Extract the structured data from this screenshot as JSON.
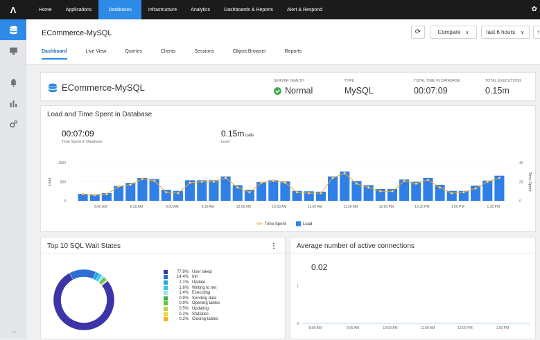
{
  "topnav": {
    "logo": "Λ",
    "items": [
      "Home",
      "Applications",
      "Databases",
      "Infrastructure",
      "Analytics",
      "Dashboards & Reports",
      "Alert & Respond"
    ],
    "active_index": 2
  },
  "header": {
    "db_name": "ECommerce-MySQL",
    "compare_label": "Compare",
    "time_range": "last 6 hours",
    "tabs": [
      "Dashboard",
      "Live View",
      "Queries",
      "Clients",
      "Sessions",
      "Object Browser",
      "Reports"
    ],
    "active_tab_index": 0
  },
  "kpis": {
    "title": "ECommerce-MySQL",
    "server_health_label": "SERVER HEALTH",
    "server_health_value": "Normal",
    "type_label": "TYPE",
    "type_value": "MySQL",
    "time_label": "TOTAL TIME IN DATABASE",
    "time_value": "00:07:09",
    "exec_label": "TOTAL EXECUTIONS",
    "exec_value": "0.15m"
  },
  "load_panel": {
    "title": "Load and Time Spent in Database",
    "time_value": "00:07:09",
    "time_caption": "Time Spent in Database",
    "calls_value": "0.15m",
    "calls_unit": "calls",
    "calls_caption": "Load"
  },
  "wait_panel": {
    "title": "Top 10 SQL Wait States",
    "menu_icon": "⋮"
  },
  "conn_panel": {
    "title": "Average number of active connections",
    "value": "0.02"
  },
  "chart_data": [
    {
      "type": "bar",
      "ylabel": "Load",
      "y2label": "Time Spent",
      "ylim": [
        0,
        1000
      ],
      "y2lim": [
        0,
        40
      ],
      "yticks": [
        "1000",
        "500",
        "0"
      ],
      "y2ticks": [
        "40",
        "20",
        "0"
      ],
      "xticks": [
        "8:00 AM",
        "8:30 AM",
        "9:00 AM",
        "9:30 AM",
        "10:00 AM",
        "10:30 AM",
        "11:00 AM",
        "11:30 AM",
        "12:00 PM",
        "12:30 PM",
        "1:00 PM",
        "1:30 PM"
      ],
      "series": [
        {
          "name": "Load",
          "type": "bar",
          "values": [
            180,
            170,
            200,
            390,
            470,
            600,
            570,
            290,
            260,
            540,
            540,
            540,
            640,
            410,
            290,
            490,
            540,
            510,
            260,
            250,
            240,
            640,
            770,
            520,
            410,
            310,
            310,
            560,
            500,
            600,
            420,
            260,
            260,
            400,
            530,
            660
          ]
        },
        {
          "name": "Time Spent",
          "type": "line",
          "values": [
            7,
            6,
            7,
            15,
            17,
            23,
            21,
            9,
            8,
            19,
            20,
            20,
            24,
            14,
            9,
            19,
            21,
            19,
            9,
            8,
            8,
            24,
            29,
            18,
            14,
            10,
            10,
            21,
            18,
            22,
            14,
            8,
            9,
            13,
            20,
            24
          ]
        }
      ],
      "legend": [
        "Time Spent",
        "Load"
      ],
      "legend_position": "bottom"
    },
    {
      "type": "pie",
      "style": "donut",
      "labels": [
        "User sleep",
        "Init",
        "Update",
        "Writing to net",
        "Executing",
        "Sending data",
        "Opening tables",
        "Updating",
        "Statistics",
        "Closing tables"
      ],
      "values": [
        77.9,
        14.4,
        2.1,
        1.6,
        1.4,
        0.9,
        0.9,
        0.5,
        0.2,
        0.2
      ],
      "display": [
        "77.9%",
        "14.4%",
        "2.1%",
        "1.6%",
        "1.4%",
        "0.9%",
        "0.9%",
        "0.5%",
        "0.2%",
        "0.2%"
      ],
      "colors": [
        "#3b35a8",
        "#2f6fd0",
        "#1ea7e4",
        "#37c8e6",
        "#a7dfee",
        "#3fae4e",
        "#69c13c",
        "#b8d43a",
        "#f0d23a",
        "#f6b01c"
      ],
      "legend_position": "right"
    },
    {
      "type": "line",
      "yticks": [
        "1",
        "0"
      ],
      "xticks": [
        "8:00 AM",
        "9:00 AM",
        "10:00 AM",
        "11:00 AM",
        "12:00 PM",
        "1:00 PM"
      ],
      "series": []
    }
  ]
}
